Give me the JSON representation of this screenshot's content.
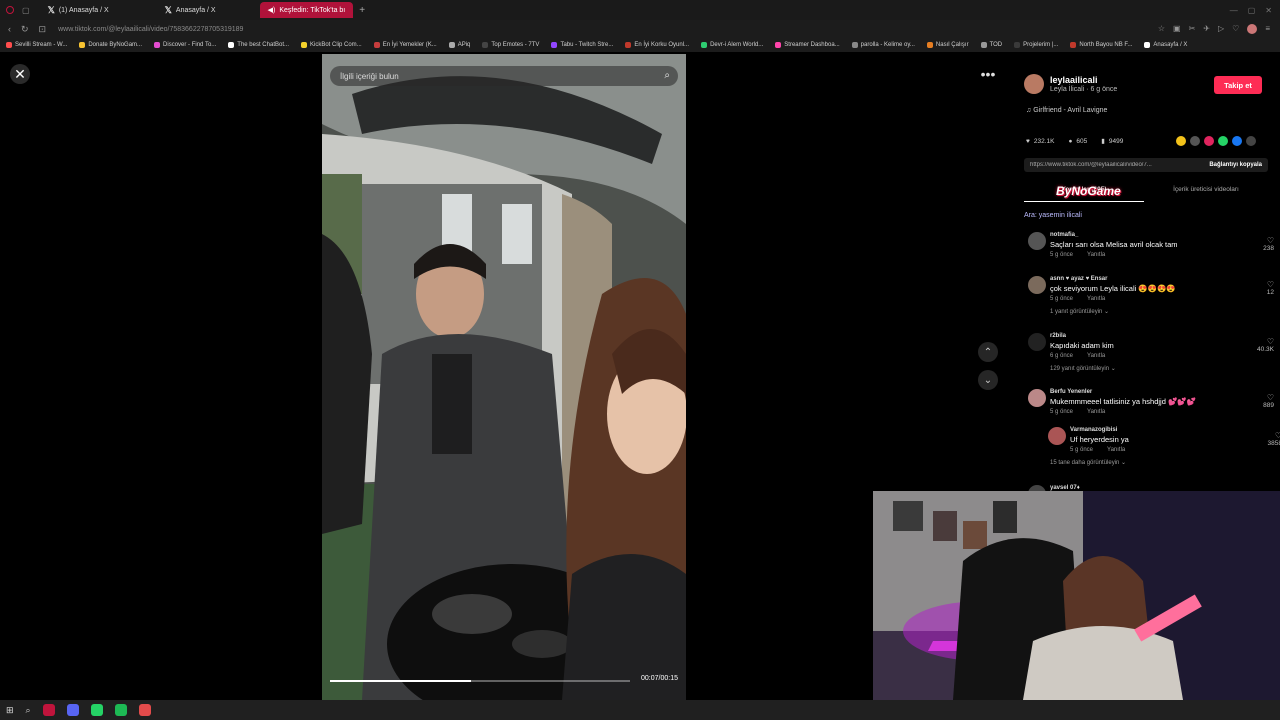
{
  "browser": {
    "tabs": [
      {
        "label": "(1) Anasayfa / X",
        "active": false
      },
      {
        "label": "Anasayfa / X",
        "active": false
      },
      {
        "label": "Keşfedin: TikTok'ta bı",
        "active": true
      }
    ],
    "url": "www.tiktok.com/@leylaailicali/video/7583662278705319189",
    "bookmarks": [
      "Sevilli Stream - W...",
      "Donate ByNoGam...",
      "Discover - Find To...",
      "The best ChatBot...",
      "KickBot Clip Com...",
      "En İyi Yemekler (K...",
      "APiq",
      "Top Emotes - 7TV",
      "Tabu - Twitch Stre...",
      "En İyi Korku Oyunl...",
      "Devr-i Alem World...",
      "Streamer Dashboa...",
      "parolla - Kelime oy...",
      "Nasıl Çalışır",
      "TOD",
      "Projelerim |...",
      "North Bayou NB F...",
      "Anasayfa / X"
    ]
  },
  "video": {
    "search_placeholder": "İlgili içeriği bulun",
    "time": "00:07/00:15",
    "progress": 0.47
  },
  "panel": {
    "author_handle": "leylaailicali",
    "author_sub": "Leyla İlicali · 6 g önce",
    "follow_label": "Takip et",
    "music": "♫  Girlfriend - Avril Lavigne",
    "likes": "232.1K",
    "comments_count": "605",
    "saves": "9499",
    "link": "https://www.tiktok.com/@leylaailicali/video/7...",
    "copy_label": "Bağlantıyı kopyala",
    "tab_comments": "Yorumlar (605)",
    "tab_creator": "İçerik üreticisi videoları",
    "watermark": "ByNoGame",
    "search_hint": "Ara: yasemin ilicali",
    "comments": [
      {
        "user": "notmafia_",
        "text": "Saçları sarı olsa Melisa avril olcak tam",
        "time": "5 g önce",
        "reply": "Yanıtla",
        "likes": "238",
        "replies": ""
      },
      {
        "user": "asnn ♥ ayaz ♥ Ensar",
        "text": "çok seviyorum Leyla ilicali 😍😍😍😍",
        "time": "5 g önce",
        "reply": "Yanıtla",
        "likes": "12",
        "replies": "1 yanıt görüntüleyin ⌄"
      },
      {
        "user": "r2bila",
        "text": "Kapıdaki adam kim",
        "time": "6 g önce",
        "reply": "Yanıtla",
        "likes": "40.3K",
        "replies": "129 yanıt görüntüleyin ⌄"
      },
      {
        "user": "Berfu Yenenler",
        "text": "Mukemmmeeel tatlisiniz ya hshdjjd 💕💕💕",
        "time": "5 g önce",
        "reply": "Yanıtla",
        "likes": "889",
        "replies": ""
      },
      {
        "user": "Varmanazogibisi",
        "text": "Uf heryerdesin ya",
        "time": "5 g önce",
        "reply": "Yanıtla",
        "likes": "3858",
        "replies": "15 tane daha görüntüleyin ⌄"
      },
      {
        "user": "yavsel 07♦",
        "text": "",
        "time": "",
        "reply": "",
        "likes": "",
        "replies": ""
      }
    ]
  },
  "colors": {
    "accent": "#fe2c55",
    "active_tab": "#b0123a",
    "background": "#000000"
  },
  "icons": {
    "close": "close-icon",
    "more": "more-icon",
    "search": "search-icon",
    "up": "chevron-up-icon",
    "down": "chevron-down-icon",
    "heart": "heart-icon"
  }
}
